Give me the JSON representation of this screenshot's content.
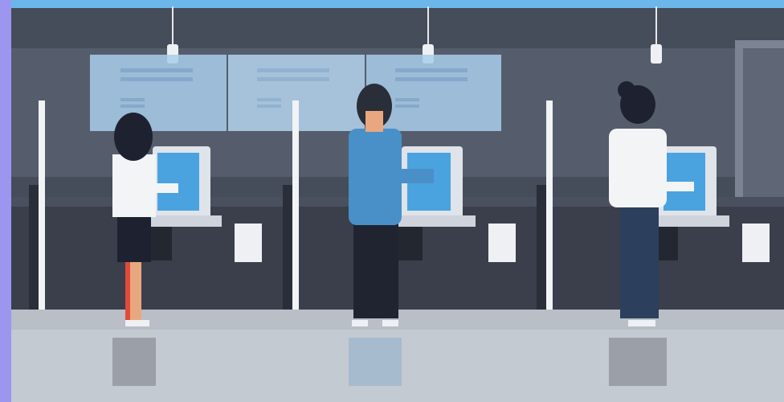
{
  "scene": {
    "description_name": "self-service-kiosk-area",
    "colors": {
      "sky_bar": "#6db6ea",
      "left_strip": "#9d96f0",
      "wall": "#454c5a",
      "wall_light": "#5c6473",
      "panel": "#a9cdeb",
      "floor": "#b9bec7",
      "counter": "#3a3f4b",
      "partition": "#e8ecf2",
      "screen": "#4aa3df",
      "kiosk_body": "#dfe3ea",
      "person_blue_shirt": "#4a90c8",
      "person_dark": "#1f2430",
      "white_shirt": "#f3f4f6",
      "skirt": "#1e2230",
      "jeans": "#2c3f5c",
      "skin": "#e9a77f",
      "red_leg": "#e24a3b"
    }
  }
}
